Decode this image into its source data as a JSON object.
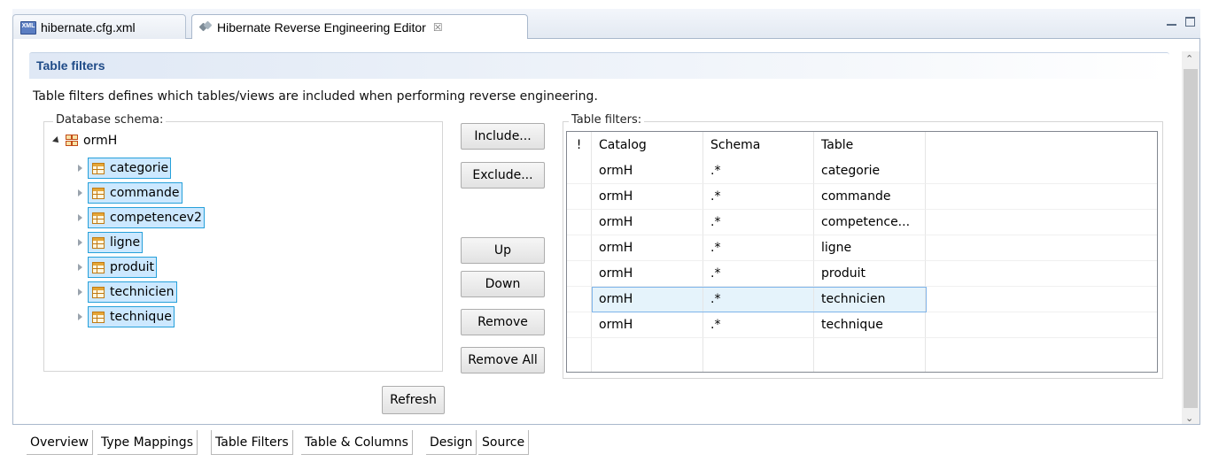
{
  "editor_tabs": [
    {
      "label": "hibernate.cfg.xml",
      "icon": "xml-file-icon"
    },
    {
      "label": "Hibernate Reverse Engineering Editor",
      "icon": "hibernate-icon",
      "close_glyph": "☒"
    }
  ],
  "section": {
    "title": "Table filters",
    "description": "Table filters defines which tables/views are included when performing reverse engineering."
  },
  "schema_group": {
    "legend": "Database schema:",
    "root": "ormH",
    "tables": [
      "categorie",
      "commande",
      "competencev2",
      "ligne",
      "produit",
      "technicien",
      "technique"
    ]
  },
  "buttons": {
    "include": "Include...",
    "exclude": "Exclude...",
    "up": "Up",
    "down": "Down",
    "remove": "Remove",
    "remove_all": "Remove All",
    "refresh": "Refresh"
  },
  "filter_group": {
    "legend": "Table filters:",
    "columns": [
      "!",
      "Catalog",
      "Schema",
      "Table"
    ],
    "rows": [
      {
        "catalog": "ormH",
        "schema": ".*",
        "table": "categorie"
      },
      {
        "catalog": "ormH",
        "schema": ".*",
        "table": "commande"
      },
      {
        "catalog": "ormH",
        "schema": ".*",
        "table": "competence..."
      },
      {
        "catalog": "ormH",
        "schema": ".*",
        "table": "ligne"
      },
      {
        "catalog": "ormH",
        "schema": ".*",
        "table": "produit"
      },
      {
        "catalog": "ormH",
        "schema": ".*",
        "table": "technicien"
      },
      {
        "catalog": "ormH",
        "schema": ".*",
        "table": "technique"
      }
    ],
    "selected_table": "technicien"
  },
  "page_tabs": [
    "Overview",
    "Type Mappings",
    "Table Filters",
    "Table & Columns",
    "Design",
    "Source"
  ],
  "active_page_tab": "Table Filters",
  "colors": {
    "accent": "#1f4b88",
    "selection": "#cce8ff",
    "selection_border": "#26a0da"
  }
}
